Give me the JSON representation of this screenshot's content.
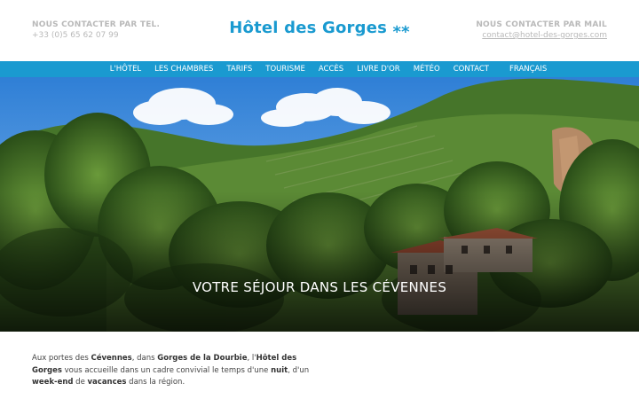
{
  "header": {
    "phone_label": "NOUS CONTACTER PAR TEL.",
    "phone_value": "+33 (0)5 65 62 07 99",
    "title": "Hôtel des Gorges ⁎⁎",
    "mail_label": "NOUS CONTACTER PAR MAIL",
    "mail_value": "contact@hotel-des-gorges.com"
  },
  "nav": {
    "items": [
      "L'HÔTEL",
      "LES CHAMBRES",
      "TARIFS",
      "TOURISME",
      "ACCÈS",
      "LIVRE D'OR",
      "MÉTÉO",
      "CONTACT"
    ],
    "language": "FRANÇAIS"
  },
  "hero": {
    "caption": "VOTRE SÉJOUR DANS LES CÉVENNES"
  },
  "intro": {
    "t1": "Aux portes des ",
    "b1": "Cévennes",
    "t2": ", dans ",
    "b2": "Gorges de la Dourbie",
    "t3": ", l'",
    "b3": "Hôtel des Gorges",
    "t4": " vous accueille dans un cadre convivial le temps d'une ",
    "b4": "nuit",
    "t5": ", d'un ",
    "b5": "week-end",
    "t6": " de ",
    "b6": "vacances",
    "t7": " dans la région."
  },
  "colors": {
    "accent": "#1a9ad0",
    "muted": "#b9b9b9",
    "forest": "#2f5a1f"
  }
}
